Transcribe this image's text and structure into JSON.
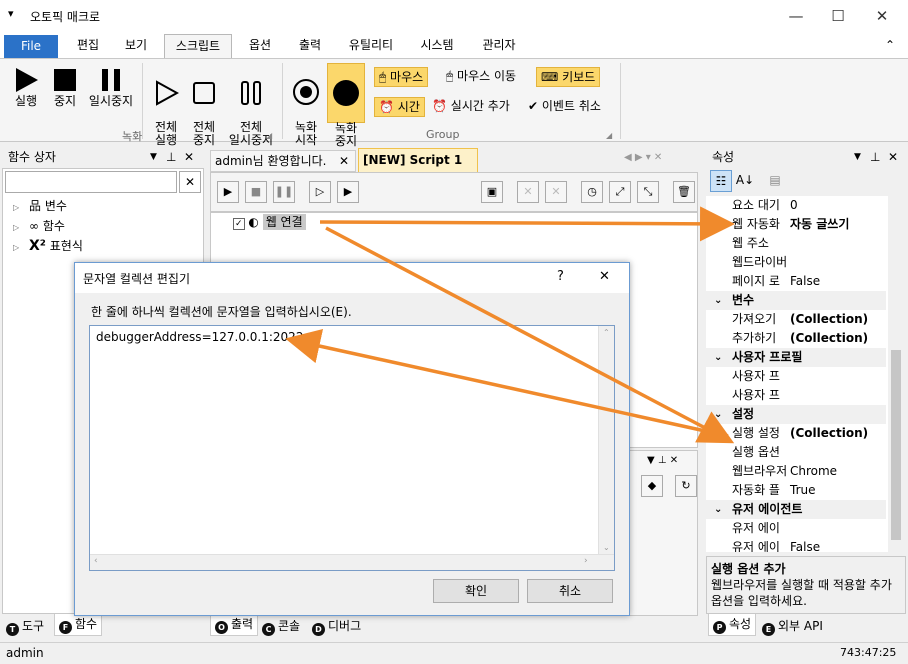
{
  "window": {
    "title": "오토픽 매크로",
    "menu_glyph": "▾",
    "min": "—",
    "max": "☐",
    "close": "✕"
  },
  "menu": {
    "tabs": [
      "File",
      "편집",
      "보기",
      "스크립트",
      "옵션",
      "출력",
      "유틸리티",
      "시스템",
      "관리자"
    ],
    "collapse": "⌃"
  },
  "ribbon": {
    "record_group": "녹화",
    "group2": "Group",
    "buttons": [
      {
        "label": "실행"
      },
      {
        "label": "중지"
      },
      {
        "label": "일시중지"
      },
      {
        "label": "전체\n실행"
      },
      {
        "label": "전체\n중지"
      },
      {
        "label": "전체\n일시중지"
      },
      {
        "label": "녹화\n시작"
      },
      {
        "label": "녹화\n중지"
      }
    ],
    "small": {
      "mouse": "마우스",
      "mouse_move": "마우스 이동",
      "keyboard": "키보드",
      "time": "시간",
      "realtime_add": "실시간 추가",
      "event_cancel": "이벤트 취소"
    }
  },
  "left_pane": {
    "title": "함수 상자",
    "search_placeholder": "",
    "clear": "✕",
    "tree": [
      {
        "label": "변수"
      },
      {
        "label": "함수"
      },
      {
        "label": "표현식"
      }
    ]
  },
  "editor": {
    "tabs": [
      "admin님 환영합니다.",
      "[NEW] Script 1"
    ],
    "node_label": "웹 연결"
  },
  "dialog": {
    "title": "문자열 컬렉션 편집기",
    "help": "?",
    "close": "✕",
    "instruction": "한 줄에 하나씩 컬렉션에 문자열을 입력하십시오(E).",
    "content": "debuggerAddress=127.0.0.1:2022",
    "ok": "확인",
    "cancel": "취소"
  },
  "properties": {
    "title": "속성",
    "rows_top": [
      {
        "k": "요소 대기",
        "v": "0"
      },
      {
        "k": "웹 자동화",
        "v": "자동 글쓰기",
        "bold": true
      },
      {
        "k": "웹 주소",
        "v": ""
      },
      {
        "k": "웹드라이버",
        "v": ""
      },
      {
        "k": "페이지 로",
        "v": "False"
      }
    ],
    "cat_var": "변수",
    "rows_var": [
      {
        "k": "가져오기",
        "v": "(Collection)"
      },
      {
        "k": "추가하기",
        "v": "(Collection)"
      }
    ],
    "cat_profile": "사용자 프로필",
    "rows_profile": [
      {
        "k": "사용자 프",
        "v": ""
      },
      {
        "k": "사용자 프",
        "v": ""
      }
    ],
    "cat_settings": "설정",
    "rows_settings": [
      {
        "k": "실행 설정",
        "v": "(Collection)"
      },
      {
        "k": "실행 옵션",
        "v": ""
      },
      {
        "k": "웹브라우저",
        "v": "Chrome"
      },
      {
        "k": "자동화 플",
        "v": "True"
      }
    ],
    "cat_agent": "유저 에이전트",
    "rows_agent": [
      {
        "k": "유저 에이",
        "v": ""
      },
      {
        "k": "유저 에이",
        "v": "False"
      }
    ],
    "desc_title": "실행 옵션 추가",
    "desc_text": "웹브라우저를 실행할 때 적용할 추가 옵션을 입력하세요."
  },
  "bottom_tabs": {
    "left": [
      {
        "badge": "T",
        "label": "도구"
      },
      {
        "badge": "F",
        "label": "함수"
      }
    ],
    "mid": [
      {
        "badge": "O",
        "label": "출력"
      },
      {
        "badge": "C",
        "label": "콘솔"
      },
      {
        "badge": "D",
        "label": "디버그"
      }
    ],
    "right": [
      {
        "badge": "P",
        "label": "속성"
      },
      {
        "badge": "E",
        "label": "외부 API"
      }
    ]
  },
  "status": {
    "user": "admin",
    "coords": "743:47:25"
  },
  "colors": {
    "accent": "#2b72c8",
    "highlight": "#fbd76b",
    "arrow": "#f08a2c"
  }
}
